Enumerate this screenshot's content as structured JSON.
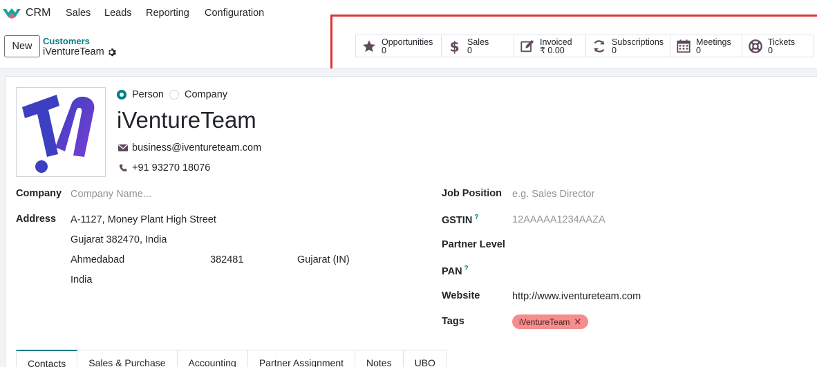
{
  "navbar": {
    "app_name": "CRM",
    "menu": [
      "Sales",
      "Leads",
      "Reporting",
      "Configuration"
    ]
  },
  "control_panel": {
    "new_label": "New",
    "breadcrumb": "Customers",
    "record_title": "iVentureTeam"
  },
  "smart_buttons": [
    {
      "icon": "star-icon",
      "label": "Opportunities",
      "value": "0"
    },
    {
      "icon": "dollar-icon",
      "label": "Sales",
      "value": "0"
    },
    {
      "icon": "pencil-square-icon",
      "label": "Invoiced",
      "value": "₹ 0.00"
    },
    {
      "icon": "refresh-icon",
      "label": "Subscriptions",
      "value": "0"
    },
    {
      "icon": "calendar-icon",
      "label": "Meetings",
      "value": "0"
    },
    {
      "icon": "life-ring-icon",
      "label": "Tickets",
      "value": "0"
    }
  ],
  "partner": {
    "type_person": "Person",
    "type_company": "Company",
    "selected_type": "Person",
    "name": "iVentureTeam",
    "email": "business@iventureteam.com",
    "phone": "+91 93270 18076"
  },
  "left_fields": {
    "company_label": "Company",
    "company_placeholder": "Company Name...",
    "address_label": "Address",
    "street": "A-1127, Money Plant High Street",
    "street2": "Gujarat 382470, India",
    "city": "Ahmedabad",
    "zip": "382481",
    "state": "Gujarat (IN)",
    "country": "India"
  },
  "right_fields": {
    "job_position_label": "Job Position",
    "job_position_placeholder": "e.g. Sales Director",
    "gstin_label": "GSTIN",
    "gstin_help": "?",
    "gstin_placeholder": "12AAAAA1234AAZA",
    "partner_level_label": "Partner Level",
    "pan_label": "PAN",
    "pan_help": "?",
    "website_label": "Website",
    "website": "http://www.iventureteam.com",
    "tags_label": "Tags",
    "tag": "iVentureTeam",
    "tag_remove": "✕"
  },
  "tabs": [
    "Contacts",
    "Sales & Purchase",
    "Accounting",
    "Partner Assignment",
    "Notes",
    "UBO"
  ],
  "colors": {
    "primary": "#017e84",
    "highlight": "#e03131",
    "tag": "#f48e8e",
    "icon": "#5e4a5c"
  }
}
